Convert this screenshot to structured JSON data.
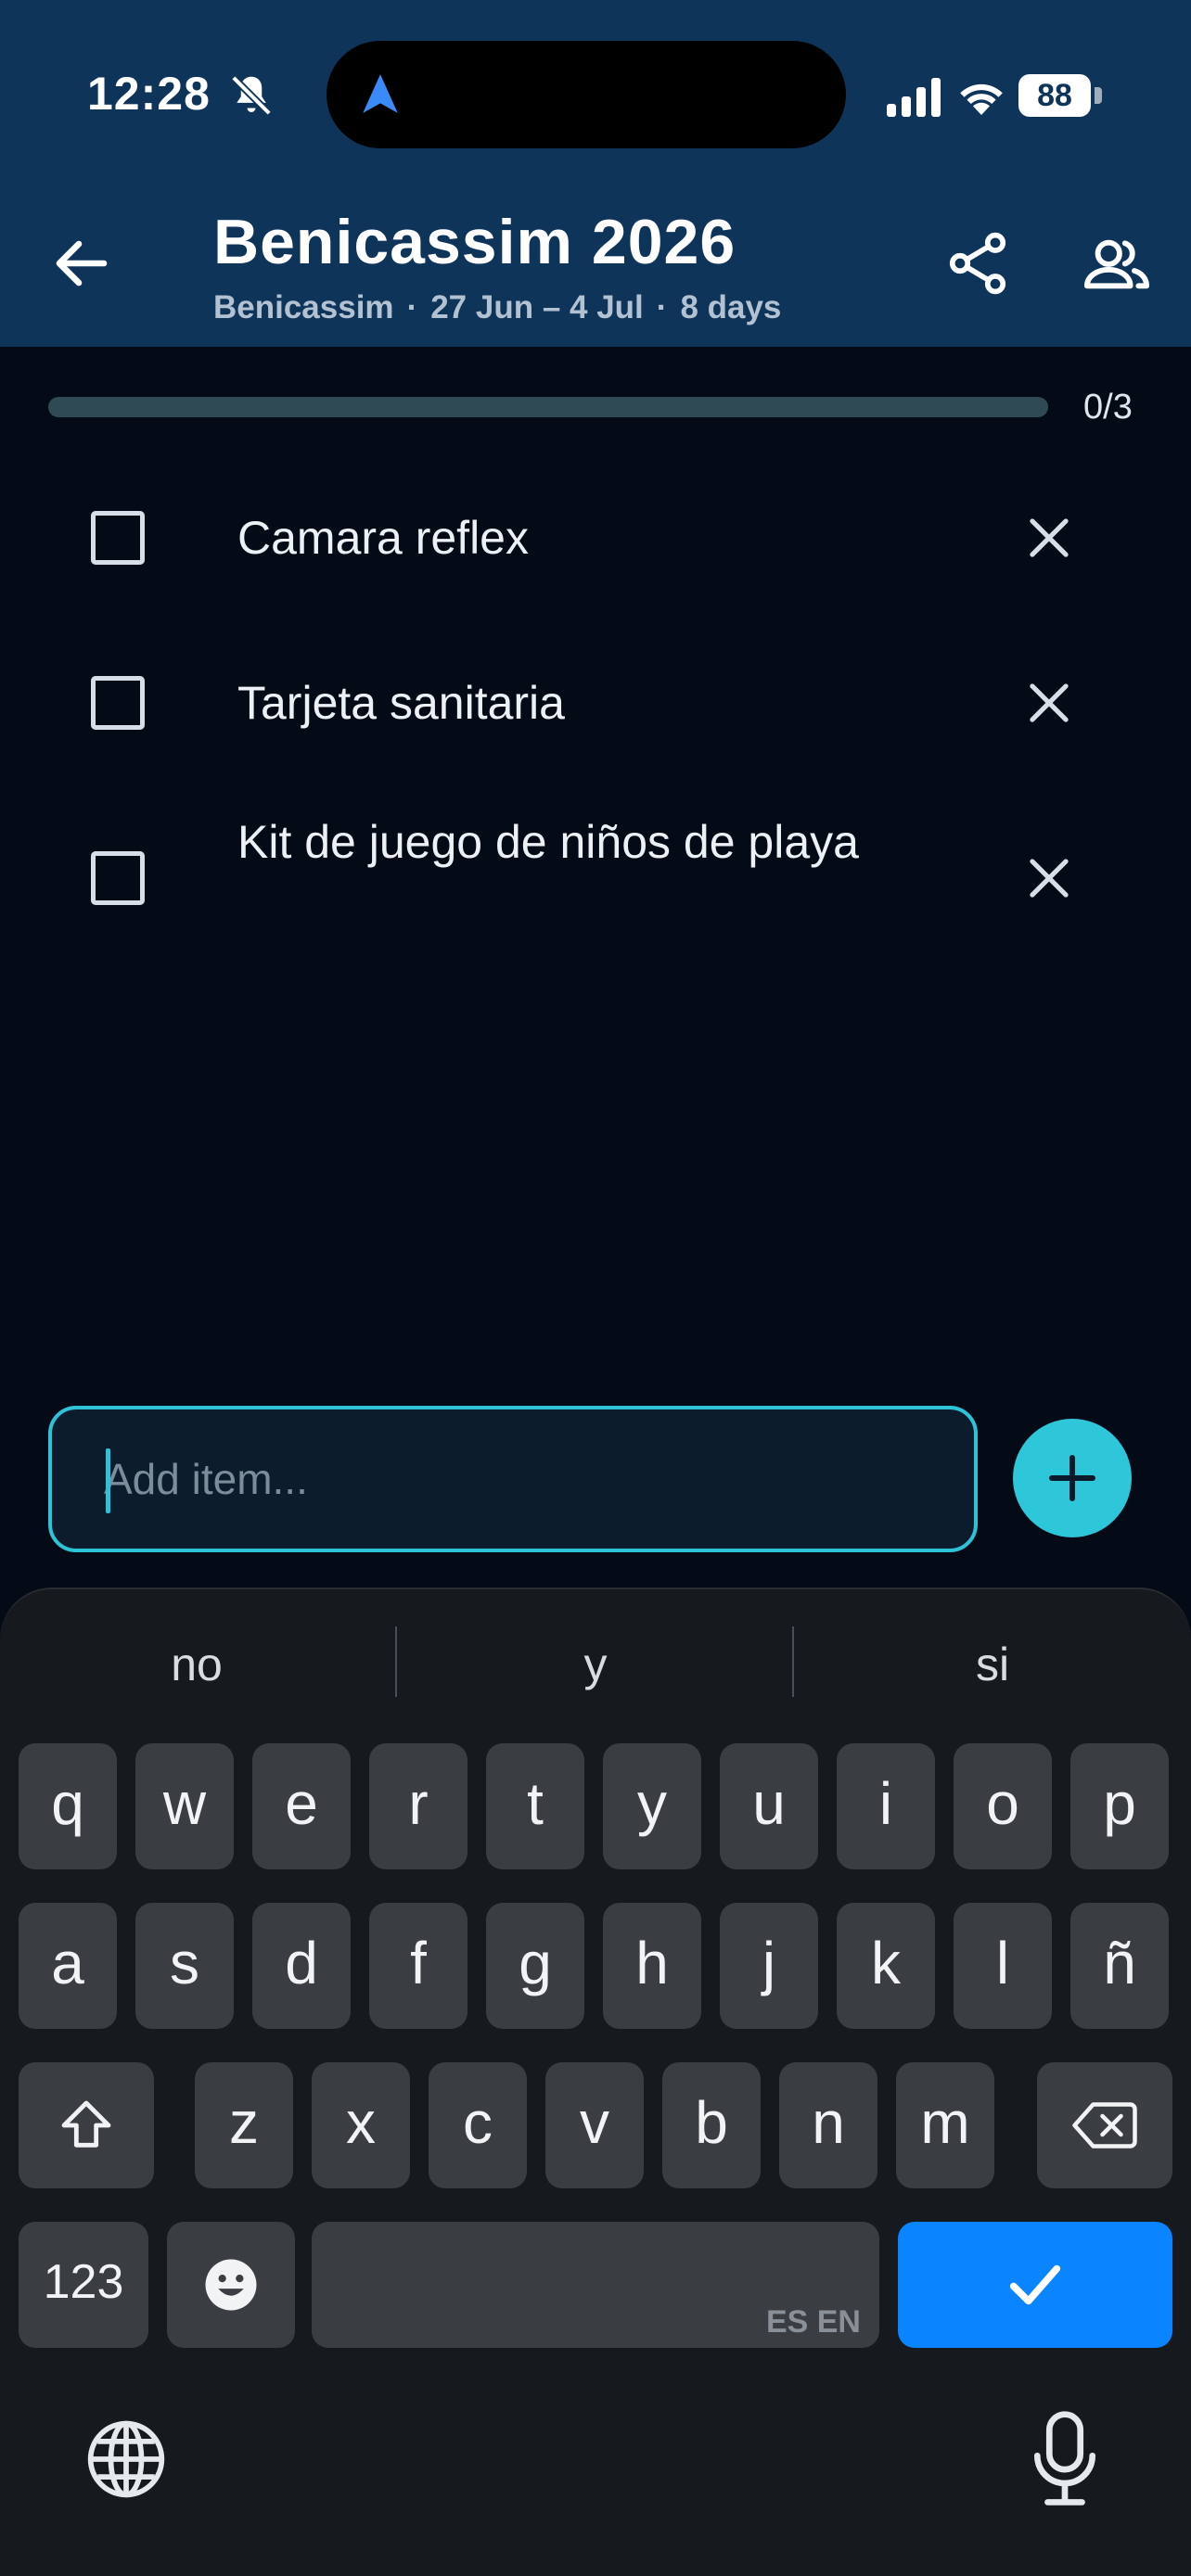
{
  "status_bar": {
    "time": "12:28",
    "battery": "88"
  },
  "header": {
    "title": "Benicassim 2026",
    "location": "Benicassim",
    "dates": "27 Jun – 4 Jul",
    "duration": "8 days",
    "separator": "·"
  },
  "progress": {
    "label": "0/3",
    "done": 0,
    "total": 3
  },
  "items": [
    {
      "label": "Camara reflex",
      "checked": false
    },
    {
      "label": "Tarjeta sanitaria",
      "checked": false
    },
    {
      "label": "Kit de juego de niños de playa",
      "checked": false
    }
  ],
  "add_item": {
    "placeholder": "Add item...",
    "value": ""
  },
  "keyboard": {
    "suggestions": [
      "no",
      "y",
      "si"
    ],
    "row1": [
      "q",
      "w",
      "e",
      "r",
      "t",
      "y",
      "u",
      "i",
      "o",
      "p"
    ],
    "row2": [
      "a",
      "s",
      "d",
      "f",
      "g",
      "h",
      "j",
      "k",
      "l",
      "ñ"
    ],
    "row3": [
      "z",
      "x",
      "c",
      "v",
      "b",
      "n",
      "m"
    ],
    "numbers_key": "123",
    "space_languages": "ES EN"
  },
  "colors": {
    "header_bg": "#0f3459",
    "page_bg": "#050b16",
    "accent": "#2ec7d9",
    "enter_key": "#0a84ff"
  }
}
